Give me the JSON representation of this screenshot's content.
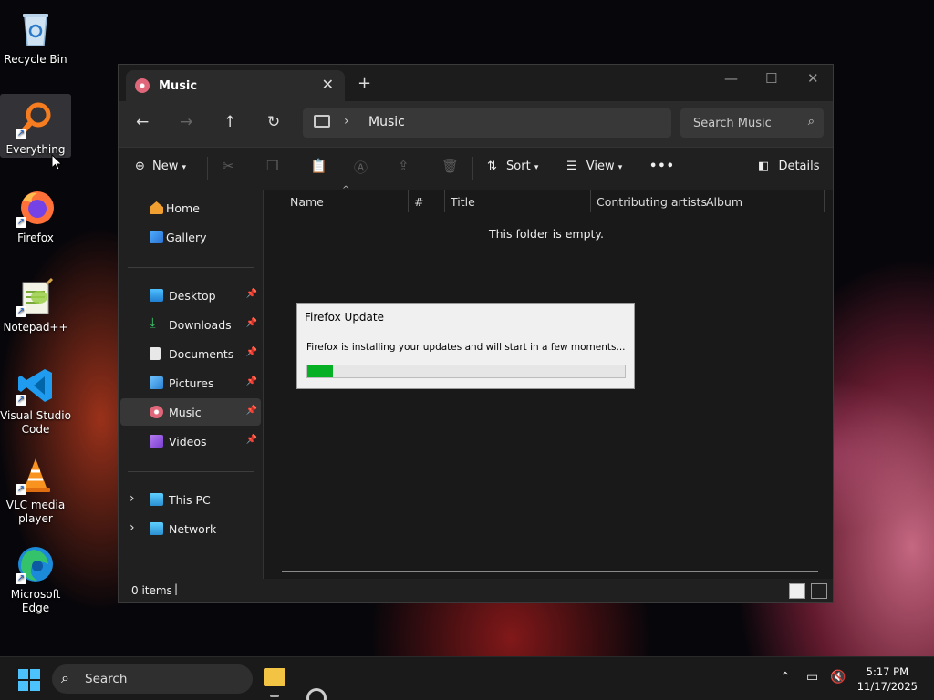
{
  "desktop": {
    "icons": [
      {
        "label": "Recycle Bin"
      },
      {
        "label": "Everything"
      },
      {
        "label": "Firefox"
      },
      {
        "label": "Notepad++"
      },
      {
        "label": "Visual Studio Code"
      },
      {
        "label": "VLC media player"
      },
      {
        "label": "Microsoft Edge"
      }
    ]
  },
  "explorer": {
    "tab_title": "Music",
    "breadcrumb": "Music",
    "search_placeholder": "Search Music",
    "toolbar": {
      "new_label": "New",
      "sort_label": "Sort",
      "view_label": "View",
      "details_label": "Details"
    },
    "sidebar": {
      "quick": [
        {
          "label": "Home"
        },
        {
          "label": "Gallery"
        }
      ],
      "pinned": [
        {
          "label": "Desktop"
        },
        {
          "label": "Downloads"
        },
        {
          "label": "Documents"
        },
        {
          "label": "Pictures"
        },
        {
          "label": "Music"
        },
        {
          "label": "Videos"
        }
      ],
      "tree": [
        {
          "label": "This PC"
        },
        {
          "label": "Network"
        }
      ]
    },
    "columns": [
      "Name",
      "#",
      "Title",
      "Contributing artists",
      "Album"
    ],
    "empty_message": "This folder is empty.",
    "status": {
      "item_count": "0 items",
      "caret": "|"
    }
  },
  "dialog": {
    "title": "Firefox Update",
    "message": "Firefox is installing your updates and will start in a few moments...",
    "progress_fraction": 0.08,
    "progress_color": "#06b025"
  },
  "taskbar": {
    "search_label": "Search",
    "time": "5:17 PM",
    "date": "11/17/2025"
  },
  "colors": {
    "accent": "#4cc2ff",
    "window_bg": "#202020"
  }
}
